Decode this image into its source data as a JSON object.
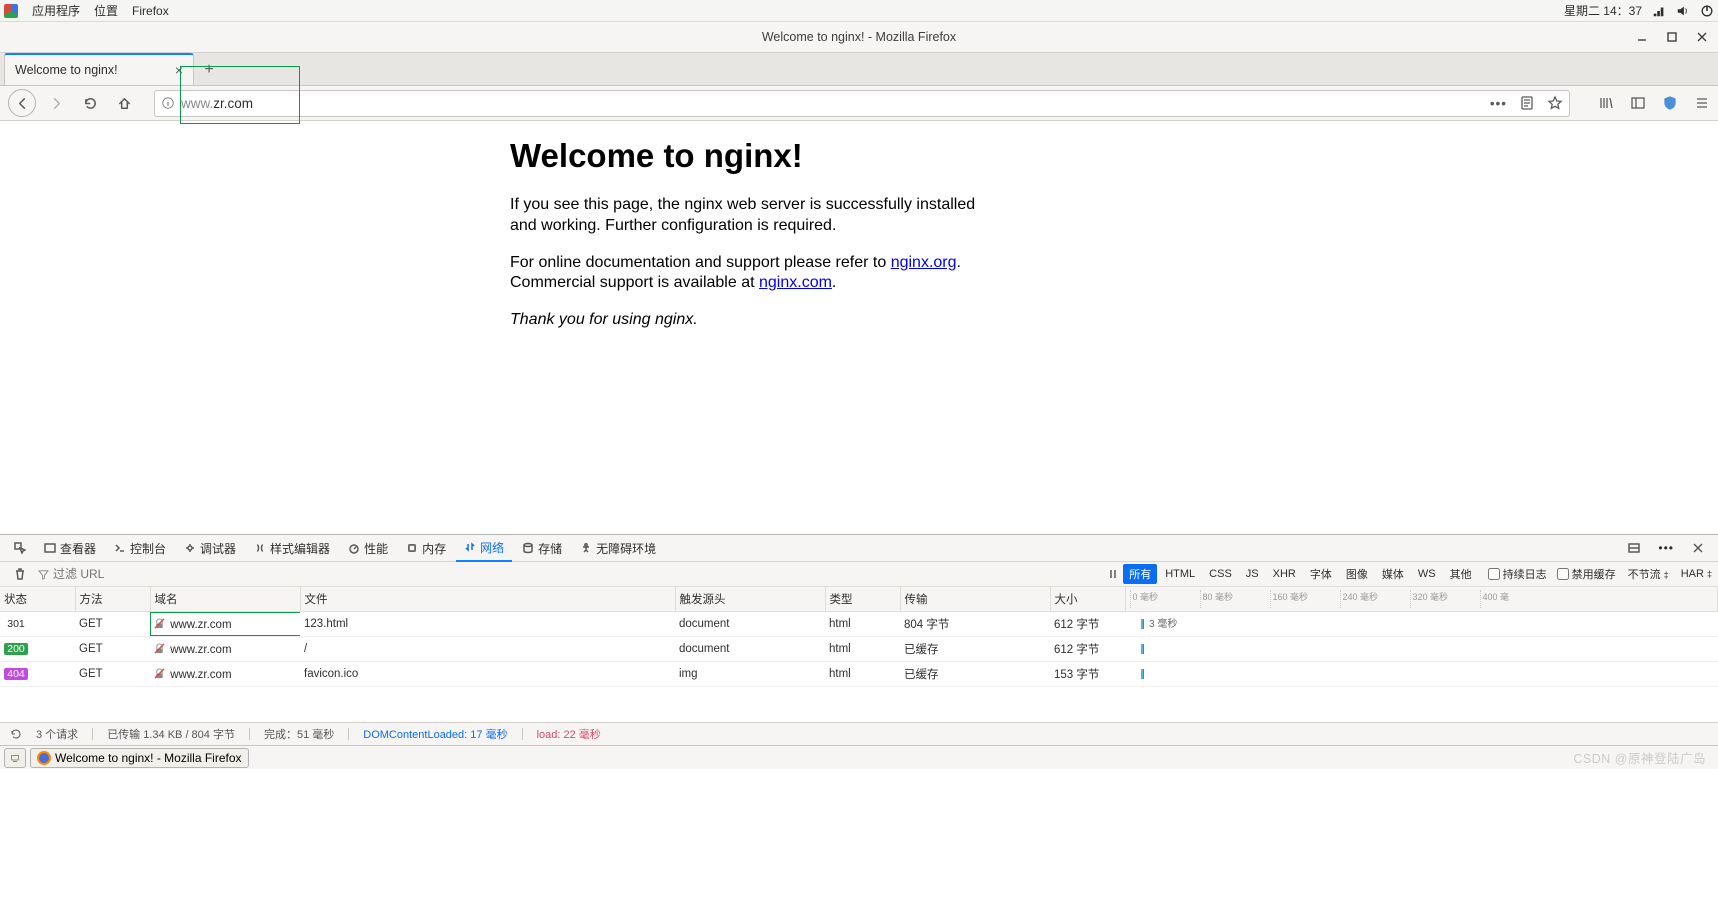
{
  "gnome": {
    "apps": "应用程序",
    "places": "位置",
    "firefox": "Firefox",
    "clock": "星期二 14：37"
  },
  "window": {
    "title": "Welcome to nginx! - Mozilla Firefox"
  },
  "tab": {
    "title": "Welcome to nginx!"
  },
  "url": {
    "dim": "www.",
    "domain": "zr.com"
  },
  "page": {
    "heading": "Welcome to nginx!",
    "p1": "If you see this page, the nginx web server is successfully installed and working. Further configuration is required.",
    "p2a": "For online documentation and support please refer to ",
    "link1": "nginx.org",
    "p2b": ".",
    "p3a": "Commercial support is available at ",
    "link2": "nginx.com",
    "p3b": ".",
    "thanks": "Thank you for using nginx."
  },
  "devtools": {
    "tools": {
      "picker": "",
      "inspector": "查看器",
      "console": "控制台",
      "debugger": "调试器",
      "style": "样式编辑器",
      "perf": "性能",
      "memory": "内存",
      "network": "网络",
      "storage": "存储",
      "a11y": "无障碍环境"
    },
    "filter_placeholder": "过滤 URL",
    "types": {
      "all": "所有",
      "html": "HTML",
      "css": "CSS",
      "js": "JS",
      "xhr": "XHR",
      "font": "字体",
      "img": "图像",
      "media": "媒体",
      "ws": "WS",
      "other": "其他"
    },
    "persist": "持续日志",
    "disable_cache": "禁用缓存",
    "throttle": "不节流",
    "har": "HAR",
    "headers": {
      "status": "状态",
      "method": "方法",
      "domain": "域名",
      "file": "文件",
      "initiator": "触发源头",
      "type": "类型",
      "transferred": "传输",
      "size": "大小"
    },
    "ticks": [
      "0 毫秒",
      "80 毫秒",
      "160 毫秒",
      "240 毫秒",
      "320 毫秒",
      "400 毫"
    ],
    "rows": [
      {
        "status": "301",
        "status_cls": "st301",
        "method": "GET",
        "domain": "www.zr.com",
        "file": "123.html",
        "initiator": "document",
        "type": "html",
        "transferred": "804 字节",
        "size": "612 字节",
        "wf_label": "3 毫秒",
        "hl": true
      },
      {
        "status": "200",
        "status_cls": "st200",
        "method": "GET",
        "domain": "www.zr.com",
        "file": "/",
        "initiator": "document",
        "type": "html",
        "transferred": "已缓存",
        "size": "612 字节",
        "wf_label": "",
        "hl": false
      },
      {
        "status": "404",
        "status_cls": "st404",
        "method": "GET",
        "domain": "www.zr.com",
        "file": "favicon.ico",
        "initiator": "img",
        "type": "html",
        "transferred": "已缓存",
        "size": "153 字节",
        "wf_label": "",
        "hl": false
      }
    ],
    "status": {
      "requests": "3 个请求",
      "transferred": "已传输 1.34 KB / 804 字节",
      "finish": "完成：51 毫秒",
      "dom": "DOMContentLoaded: 17 毫秒",
      "load": "load: 22 毫秒"
    }
  },
  "taskbar": {
    "app": "Welcome to nginx! - Mozilla Firefox"
  },
  "watermark": "CSDN @原神登陆广岛"
}
